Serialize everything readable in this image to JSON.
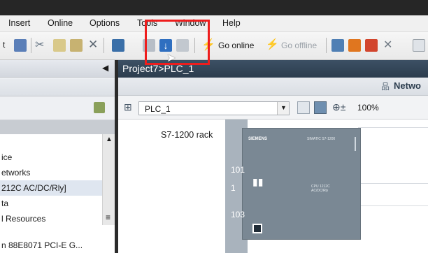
{
  "menu": {
    "items": [
      "Insert",
      "Online",
      "Options",
      "Tools",
      "Window",
      "Help"
    ]
  },
  "toolbar": {
    "go_online": "Go online",
    "go_offline": "Go offline"
  },
  "editor": {
    "breadcrumb": "Project7>PLC_1",
    "network_tab": "Netwo",
    "device_select": "PLC_1",
    "zoom": "100%",
    "rack_label": "S7-1200 rack",
    "slots": [
      "101",
      "1",
      "103"
    ],
    "module": {
      "brand": "SIEMENS",
      "model_line": "SIMATIC S7-1200",
      "cpu_line1": "CPU 1212C",
      "cpu_line2": "AC/DC/Rly"
    }
  },
  "tree": {
    "rows": [
      "ice",
      "etworks",
      "212C AC/DC/Rly]",
      "ta",
      "l Resources"
    ],
    "footer_row": "n 88E8071 PCI-E G..."
  },
  "colors": {
    "accent_red": "#ee1d1d",
    "title_bar": "#2c3d4e",
    "rack_gray": "#7d8a95"
  },
  "icons": [
    "print-icon",
    "cut-icon",
    "copy-icon",
    "paste-icon",
    "delete-icon",
    "compile-icon",
    "download-icon",
    "upload-icon",
    "go-online-icon",
    "go-offline-icon",
    "accessible-devices-icon",
    "cross-icon"
  ]
}
